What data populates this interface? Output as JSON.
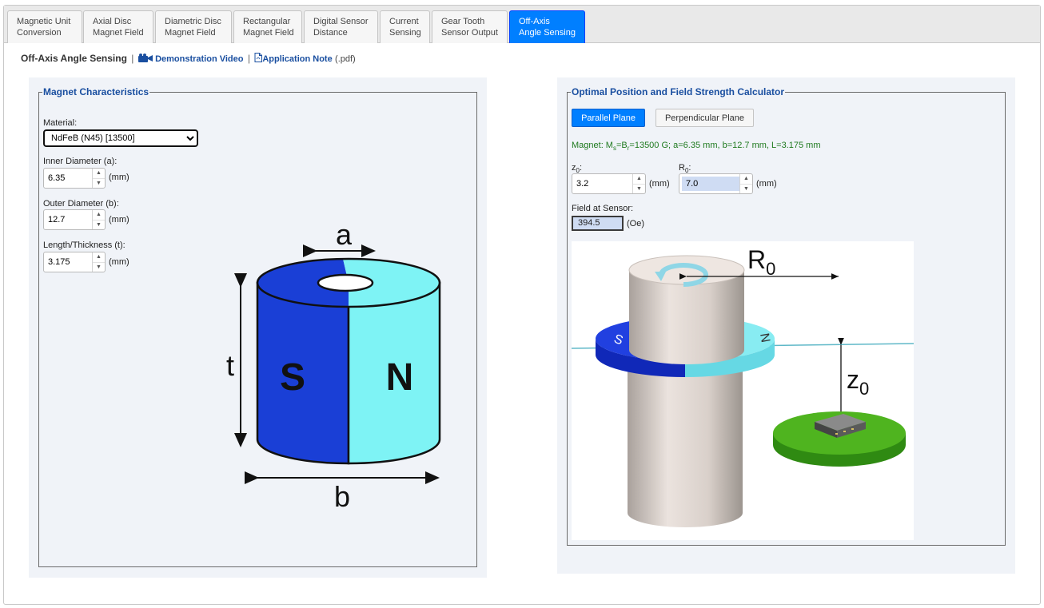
{
  "tabs": [
    {
      "line1": "Magnetic Unit",
      "line2": "Conversion"
    },
    {
      "line1": "Axial Disc",
      "line2": "Magnet Field"
    },
    {
      "line1": "Diametric Disc",
      "line2": "Magnet Field"
    },
    {
      "line1": "Rectangular",
      "line2": "Magnet Field"
    },
    {
      "line1": "Digital Sensor",
      "line2": "Distance"
    },
    {
      "line1": "Current",
      "line2": "Sensing"
    },
    {
      "line1": "Gear Tooth",
      "line2": "Sensor Output"
    },
    {
      "line1": "Off-Axis",
      "line2": "Angle Sensing"
    }
  ],
  "header": {
    "title": "Off-Axis Angle Sensing",
    "sep": "|",
    "video_link": "Demonstration Video",
    "note_link": "Application Note",
    "note_suffix": "(.pdf)"
  },
  "magnet": {
    "legend": "Magnet Characteristics",
    "material_label": "Material:",
    "material_value": "NdFeB (N45) [13500]",
    "inner_label": "Inner Diameter (a):",
    "inner_value": "6.35",
    "outer_label": "Outer Diameter (b):",
    "outer_value": "12.7",
    "length_label": "Length/Thickness (t):",
    "length_value": "3.175",
    "unit": "(mm)",
    "diagram": {
      "a": "a",
      "b": "b",
      "t": "t",
      "s": "S",
      "n": "N"
    }
  },
  "calc": {
    "legend": "Optimal Position and Field Strength Calculator",
    "parallel_btn": "Parallel Plane",
    "perp_btn": "Perpendicular Plane",
    "info": {
      "prefix": "Magnet: M",
      "sub_s": "s",
      "eq": "=B",
      "sub_r": "r",
      "rest": "=13500 G; a=6.35 mm, b=12.7 mm, L=3.175 mm"
    },
    "z0_label": "z",
    "z0_sub": "0",
    "z0_value": "3.2",
    "r0_label": "R",
    "r0_sub": "0",
    "r0_value": "7.0",
    "unit_mm": "(mm)",
    "field_label": "Field at Sensor:",
    "field_value": "394.5",
    "unit_oe": "(Oe)",
    "diagram": {
      "r0": "R",
      "r0_sub": "0",
      "z0": "z",
      "z0_sub": "0",
      "s": "S",
      "n": "N"
    }
  },
  "colors": {
    "accent": "#007fff",
    "legend": "#1a4fa0",
    "info": "#1f7a1f",
    "south": "#1a3fd6",
    "north": "#7ef3f5"
  }
}
